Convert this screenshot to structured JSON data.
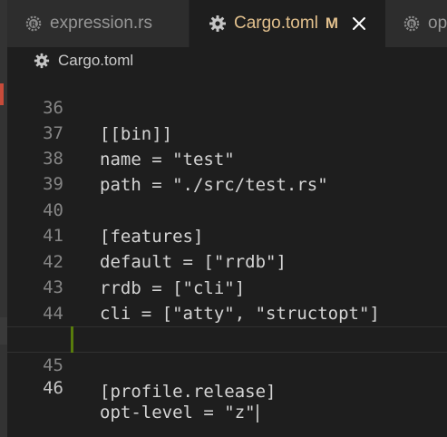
{
  "tabs": [
    {
      "label": "expression.rs",
      "icon": "rust-icon",
      "state": "inactive"
    },
    {
      "label": "Cargo.toml",
      "icon": "gear-icon",
      "state": "active",
      "modified": "M",
      "close": "×"
    },
    {
      "label": "op",
      "icon": "rust-icon",
      "state": "inactive-truncated"
    }
  ],
  "breadcrumb": {
    "label": "Cargo.toml",
    "icon": "gear-icon"
  },
  "editor": {
    "lines": [
      {
        "num": "36",
        "text": "[[bin]]"
      },
      {
        "num": "37",
        "text": "name = \"test\""
      },
      {
        "num": "38",
        "text": "path = \"./src/test.rs\""
      },
      {
        "num": "39",
        "text": ""
      },
      {
        "num": "40",
        "text": "[features]"
      },
      {
        "num": "41",
        "text": "default = [\"rrdb\"]"
      },
      {
        "num": "42",
        "text": "rrdb = [\"cli\"]"
      },
      {
        "num": "43",
        "text": "cli = [\"atty\", \"structopt\"]"
      },
      {
        "num": "44",
        "text": ""
      },
      {
        "num": "45",
        "text": "[profile.release]"
      },
      {
        "num": "46",
        "text": "opt-level = \"z\""
      }
    ],
    "current_line": "46",
    "changed_lines": [
      "45",
      "46"
    ]
  },
  "colors": {
    "editor_bg": "#1e1e1e",
    "tab_inactive_bg": "#2d2d2d",
    "tab_active_fg": "#e2c08d",
    "line_number_fg": "#858585",
    "code_fg": "#d4d4d4",
    "diff_added": "#587c0c"
  }
}
